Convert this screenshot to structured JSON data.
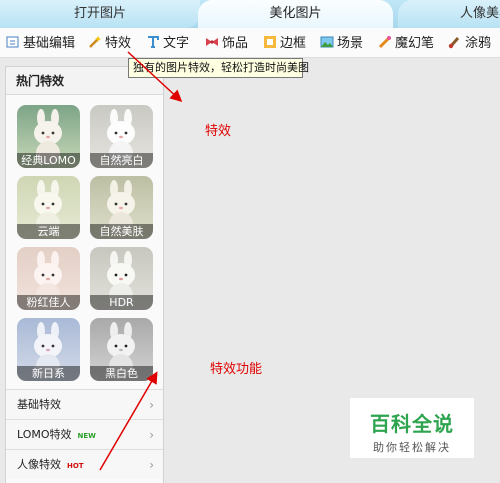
{
  "tabs": [
    "打开图片",
    "美化图片",
    "人像美容"
  ],
  "toolbar": [
    {
      "label": "基础编辑",
      "icon": "edit-icon"
    },
    {
      "label": "特效",
      "icon": "magic-wand-icon"
    },
    {
      "label": "文字",
      "icon": "text-icon"
    },
    {
      "label": "饰品",
      "icon": "bow-icon"
    },
    {
      "label": "边框",
      "icon": "frame-icon"
    },
    {
      "label": "场景",
      "icon": "landscape-icon"
    },
    {
      "label": "魔幻笔",
      "icon": "magic-pen-icon"
    },
    {
      "label": "涂鸦",
      "icon": "brush-icon"
    }
  ],
  "tooltip": "独有的图片特效，轻松打造时尚美图",
  "panel": {
    "title": "热门特效",
    "effects": [
      "经典LOMO",
      "自然亮白",
      "云端",
      "自然美肤",
      "粉红佳人",
      "HDR",
      "新日系",
      "黑白色"
    ],
    "categories": [
      {
        "label": "基础特效",
        "badge": ""
      },
      {
        "label": "LOMO特效",
        "badge": "NEW"
      },
      {
        "label": "人像特效",
        "badge": "HOT"
      }
    ]
  },
  "annotations": [
    "特效",
    "特效功能"
  ],
  "watermark": {
    "title": "百科全说",
    "subtitle": "助你轻松解决"
  },
  "colors": {
    "annotation": "#e00000",
    "badge_new": "#2aa02a",
    "badge_hot": "#d01010",
    "watermark_green": "#2ea44f"
  }
}
